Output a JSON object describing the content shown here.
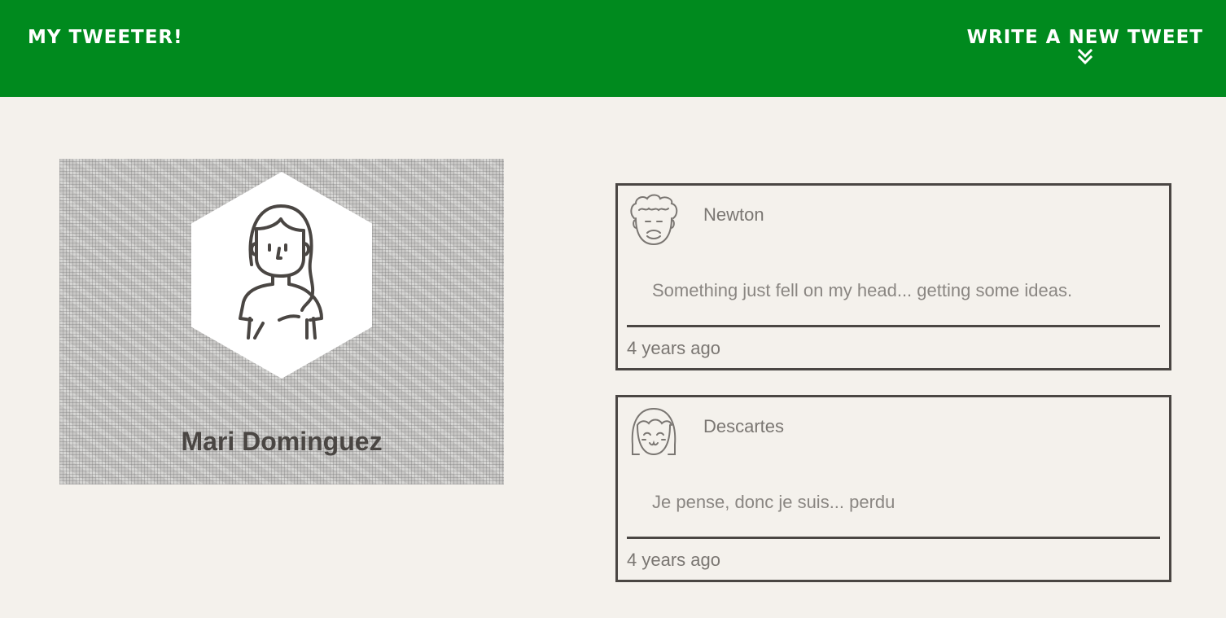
{
  "header": {
    "brand": "My Tweeter!",
    "compose_label": "Write a new tweet",
    "compose_icon": "double-chevron-down-icon",
    "background_color": "#008a1e"
  },
  "profile": {
    "name": "Mari Dominguez",
    "avatar_icon": "woman-avatar-icon"
  },
  "tweets": [
    {
      "handle": "Newton",
      "avatar_icon": "curly-hair-man-avatar-icon",
      "text": "Something just fell on my head... getting some ideas.",
      "time": "4 years ago"
    },
    {
      "handle": "Descartes",
      "avatar_icon": "smiling-bangs-avatar-icon",
      "text": "Je pense, donc je suis... perdu",
      "time": "4 years ago"
    }
  ]
}
